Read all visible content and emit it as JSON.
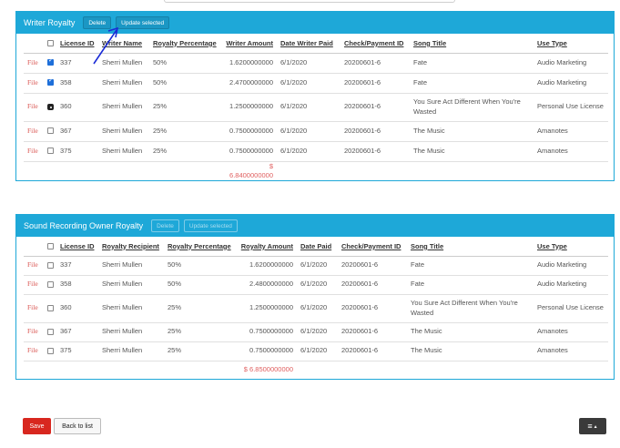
{
  "top_dropdown": {},
  "writer_panel": {
    "title": "Writer Royalty",
    "delete_label": "Delete",
    "update_label": "Update selected",
    "columns": [
      "License ID",
      "Writer Name",
      "Royalty Percentage",
      "Writer Amount",
      "Date Writer Paid",
      "Check/Payment ID",
      "Song Title",
      "Use Type"
    ],
    "rows": [
      {
        "file": "File",
        "checked": "checked",
        "license_id": "337",
        "writer_name": "Sherri Mullen",
        "royalty_percentage": "50%",
        "amount": "1.6200000000",
        "date_paid": "6/1/2020",
        "payment_id": "20200601-6",
        "song_title": "Fate",
        "use_type": "Audio Marketing"
      },
      {
        "file": "File",
        "checked": "checked",
        "license_id": "358",
        "writer_name": "Sherri Mullen",
        "royalty_percentage": "50%",
        "amount": "2.4700000000",
        "date_paid": "6/1/2020",
        "payment_id": "20200601-6",
        "song_title": "Fate",
        "use_type": "Audio Marketing"
      },
      {
        "file": "File",
        "checked": "focused",
        "license_id": "360",
        "writer_name": "Sherri Mullen",
        "royalty_percentage": "25%",
        "amount": "1.2500000000",
        "date_paid": "6/1/2020",
        "payment_id": "20200601-6",
        "song_title": "You Sure Act Different When You're Wasted",
        "use_type": "Personal Use License"
      },
      {
        "file": "File",
        "checked": "unchecked",
        "license_id": "367",
        "writer_name": "Sherri Mullen",
        "royalty_percentage": "25%",
        "amount": "0.7500000000",
        "date_paid": "6/1/2020",
        "payment_id": "20200601-6",
        "song_title": "The Music",
        "use_type": "Amanotes"
      },
      {
        "file": "File",
        "checked": "unchecked",
        "license_id": "375",
        "writer_name": "Sherri Mullen",
        "royalty_percentage": "25%",
        "amount": "0.7500000000",
        "date_paid": "6/1/2020",
        "payment_id": "20200601-6",
        "song_title": "The Music",
        "use_type": "Amanotes"
      }
    ],
    "total": "$ 6.8400000000"
  },
  "sound_panel": {
    "title": "Sound Recording Owner Royalty",
    "delete_label": "Delete",
    "update_label": "Update selected",
    "columns": [
      "License ID",
      "Royalty Recipient",
      "Royalty Percentage",
      "Royalty Amount",
      "Date Paid",
      "Check/Payment ID",
      "Song Title",
      "Use Type"
    ],
    "rows": [
      {
        "file": "File",
        "checked": "unchecked",
        "license_id": "337",
        "writer_name": "Sherri Mullen",
        "royalty_percentage": "50%",
        "amount": "1.6200000000",
        "date_paid": "6/1/2020",
        "payment_id": "20200601-6",
        "song_title": "Fate",
        "use_type": "Audio Marketing"
      },
      {
        "file": "File",
        "checked": "unchecked",
        "license_id": "358",
        "writer_name": "Sherri Mullen",
        "royalty_percentage": "50%",
        "amount": "2.4800000000",
        "date_paid": "6/1/2020",
        "payment_id": "20200601-6",
        "song_title": "Fate",
        "use_type": "Audio Marketing"
      },
      {
        "file": "File",
        "checked": "unchecked",
        "license_id": "360",
        "writer_name": "Sherri Mullen",
        "royalty_percentage": "25%",
        "amount": "1.2500000000",
        "date_paid": "6/1/2020",
        "payment_id": "20200601-6",
        "song_title": "You Sure Act Different When You're Wasted",
        "use_type": "Personal Use License"
      },
      {
        "file": "File",
        "checked": "unchecked",
        "license_id": "367",
        "writer_name": "Sherri Mullen",
        "royalty_percentage": "25%",
        "amount": "0.7500000000",
        "date_paid": "6/1/2020",
        "payment_id": "20200601-6",
        "song_title": "The Music",
        "use_type": "Amanotes"
      },
      {
        "file": "File",
        "checked": "unchecked",
        "license_id": "375",
        "writer_name": "Sherri Mullen",
        "royalty_percentage": "25%",
        "amount": "0.7500000000",
        "date_paid": "6/1/2020",
        "payment_id": "20200601-6",
        "song_title": "The Music",
        "use_type": "Amanotes"
      }
    ],
    "total": "$ 6.8500000000"
  },
  "footer": {
    "save_label": "Save",
    "back_label": "Back to list",
    "menu_icon": "hamburger-icon",
    "menu_caret": "▲"
  },
  "colors": {
    "panel_header": "#1ea8d8",
    "save_button": "#d8271f",
    "file_link": "#d9534f",
    "total_text": "#e06060",
    "arrow": "#1a2bd6"
  }
}
